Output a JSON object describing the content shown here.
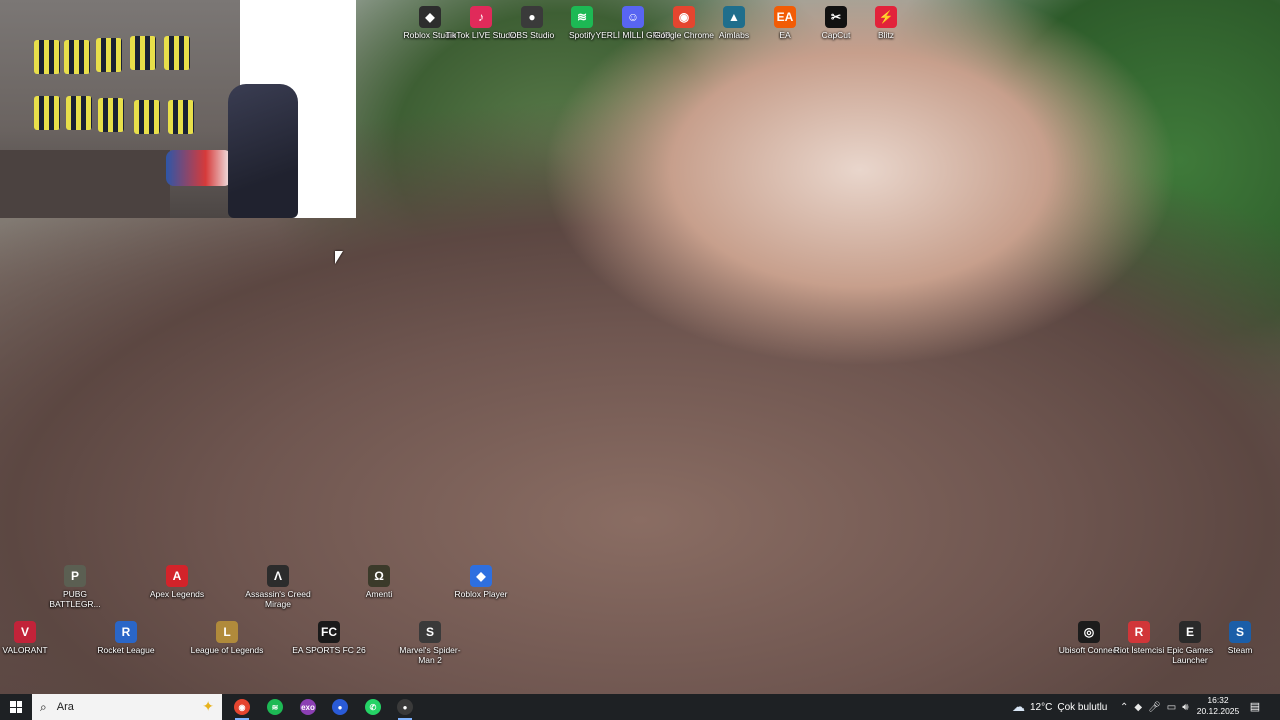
{
  "desktop_icons_top": [
    {
      "name": "roblox-studio-icon",
      "label": "Roblox Studio",
      "color": "#2d2d2d",
      "glyph": "◆"
    },
    {
      "name": "tiktok-live-studio-icon",
      "label": "TikTok LIVE Studio",
      "color": "#e02a5a",
      "glyph": "♪"
    },
    {
      "name": "obs-studio-icon",
      "label": "OBS Studio",
      "color": "#3a3a3a",
      "glyph": "●"
    },
    {
      "name": "spotify-icon",
      "label": "Spotify",
      "color": "#1db954",
      "glyph": "≋"
    },
    {
      "name": "discord-icon",
      "label": "YERLİ MİLLİ GRUP",
      "color": "#5865f2",
      "glyph": "☺"
    },
    {
      "name": "chrome-icon",
      "label": "Google Chrome",
      "color": "#e5452f",
      "glyph": "◉"
    },
    {
      "name": "aimlabs-icon",
      "label": "Aimlabs",
      "color": "#1f6e8c",
      "glyph": "▲"
    },
    {
      "name": "ea-icon",
      "label": "EA",
      "color": "#f25c05",
      "glyph": "EA"
    },
    {
      "name": "capcut-icon",
      "label": "CapCut",
      "color": "#111111",
      "glyph": "✂"
    },
    {
      "name": "blitz-icon",
      "label": "Blitz",
      "color": "#e2233b",
      "glyph": "⚡"
    }
  ],
  "desktop_icons_row1": [
    {
      "name": "pubg-icon",
      "label": "PUBG BATTLEGR...",
      "color": "#5b5f52",
      "glyph": "P"
    },
    {
      "name": "apex-legends-icon",
      "label": "Apex Legends",
      "color": "#d3232a",
      "glyph": "A"
    },
    {
      "name": "assassins-creed-icon",
      "label": "Assassin's Creed Mirage",
      "color": "#2c2c2c",
      "glyph": "Λ"
    },
    {
      "name": "amenti-icon",
      "label": "Amenti",
      "color": "#3b3a2a",
      "glyph": "Ω"
    },
    {
      "name": "roblox-player-icon",
      "label": "Roblox Player",
      "color": "#2e6fe0",
      "glyph": "◆"
    }
  ],
  "desktop_icons_row2": [
    {
      "name": "valorant-icon",
      "label": "VALORANT",
      "color": "#c22339",
      "glyph": "V"
    },
    {
      "name": "rocket-league-icon",
      "label": "Rocket League",
      "color": "#2a66c7",
      "glyph": "R"
    },
    {
      "name": "league-of-legends-icon",
      "label": "League of Legends",
      "color": "#b08a3b",
      "glyph": "L"
    },
    {
      "name": "ea-sports-fc-icon",
      "label": "EA SPORTS FC 26",
      "color": "#1a1a1a",
      "glyph": "FC"
    },
    {
      "name": "marvels-spiderman-icon",
      "label": "Marvel's Spider-Man 2",
      "color": "#3a3a3a",
      "glyph": "S"
    }
  ],
  "desktop_icons_right": [
    {
      "name": "ubisoft-connect-icon",
      "label": "Ubisoft Connect",
      "color": "#1c1c1c",
      "glyph": "◎"
    },
    {
      "name": "riot-client-icon",
      "label": "Riot İstemcisi",
      "color": "#d13639",
      "glyph": "R"
    },
    {
      "name": "epic-games-icon",
      "label": "Epic Games Launcher",
      "color": "#2a2a2a",
      "glyph": "E"
    },
    {
      "name": "steam-icon",
      "label": "Steam",
      "color": "#1b5ea8",
      "glyph": "S"
    }
  ],
  "taskbar": {
    "search_placeholder": "Ara",
    "apps": [
      {
        "name": "taskbar-chrome-icon",
        "color": "#e5452f",
        "glyph": "◉",
        "active": true
      },
      {
        "name": "taskbar-spotify-icon",
        "color": "#1db954",
        "glyph": "≋",
        "active": false
      },
      {
        "name": "taskbar-exo-icon",
        "color": "#8b3fb3",
        "glyph": "exo",
        "active": false
      },
      {
        "name": "taskbar-steam-icon",
        "color": "#2a5bd7",
        "glyph": "●",
        "active": false
      },
      {
        "name": "taskbar-whatsapp-icon",
        "color": "#25d366",
        "glyph": "✆",
        "active": false
      },
      {
        "name": "taskbar-obs-icon",
        "color": "#3a3a3a",
        "glyph": "●",
        "active": true
      }
    ],
    "weather_temp": "12°C",
    "weather_desc": "Çok bulutlu",
    "time": "16:32",
    "date": "20.12.2025"
  }
}
